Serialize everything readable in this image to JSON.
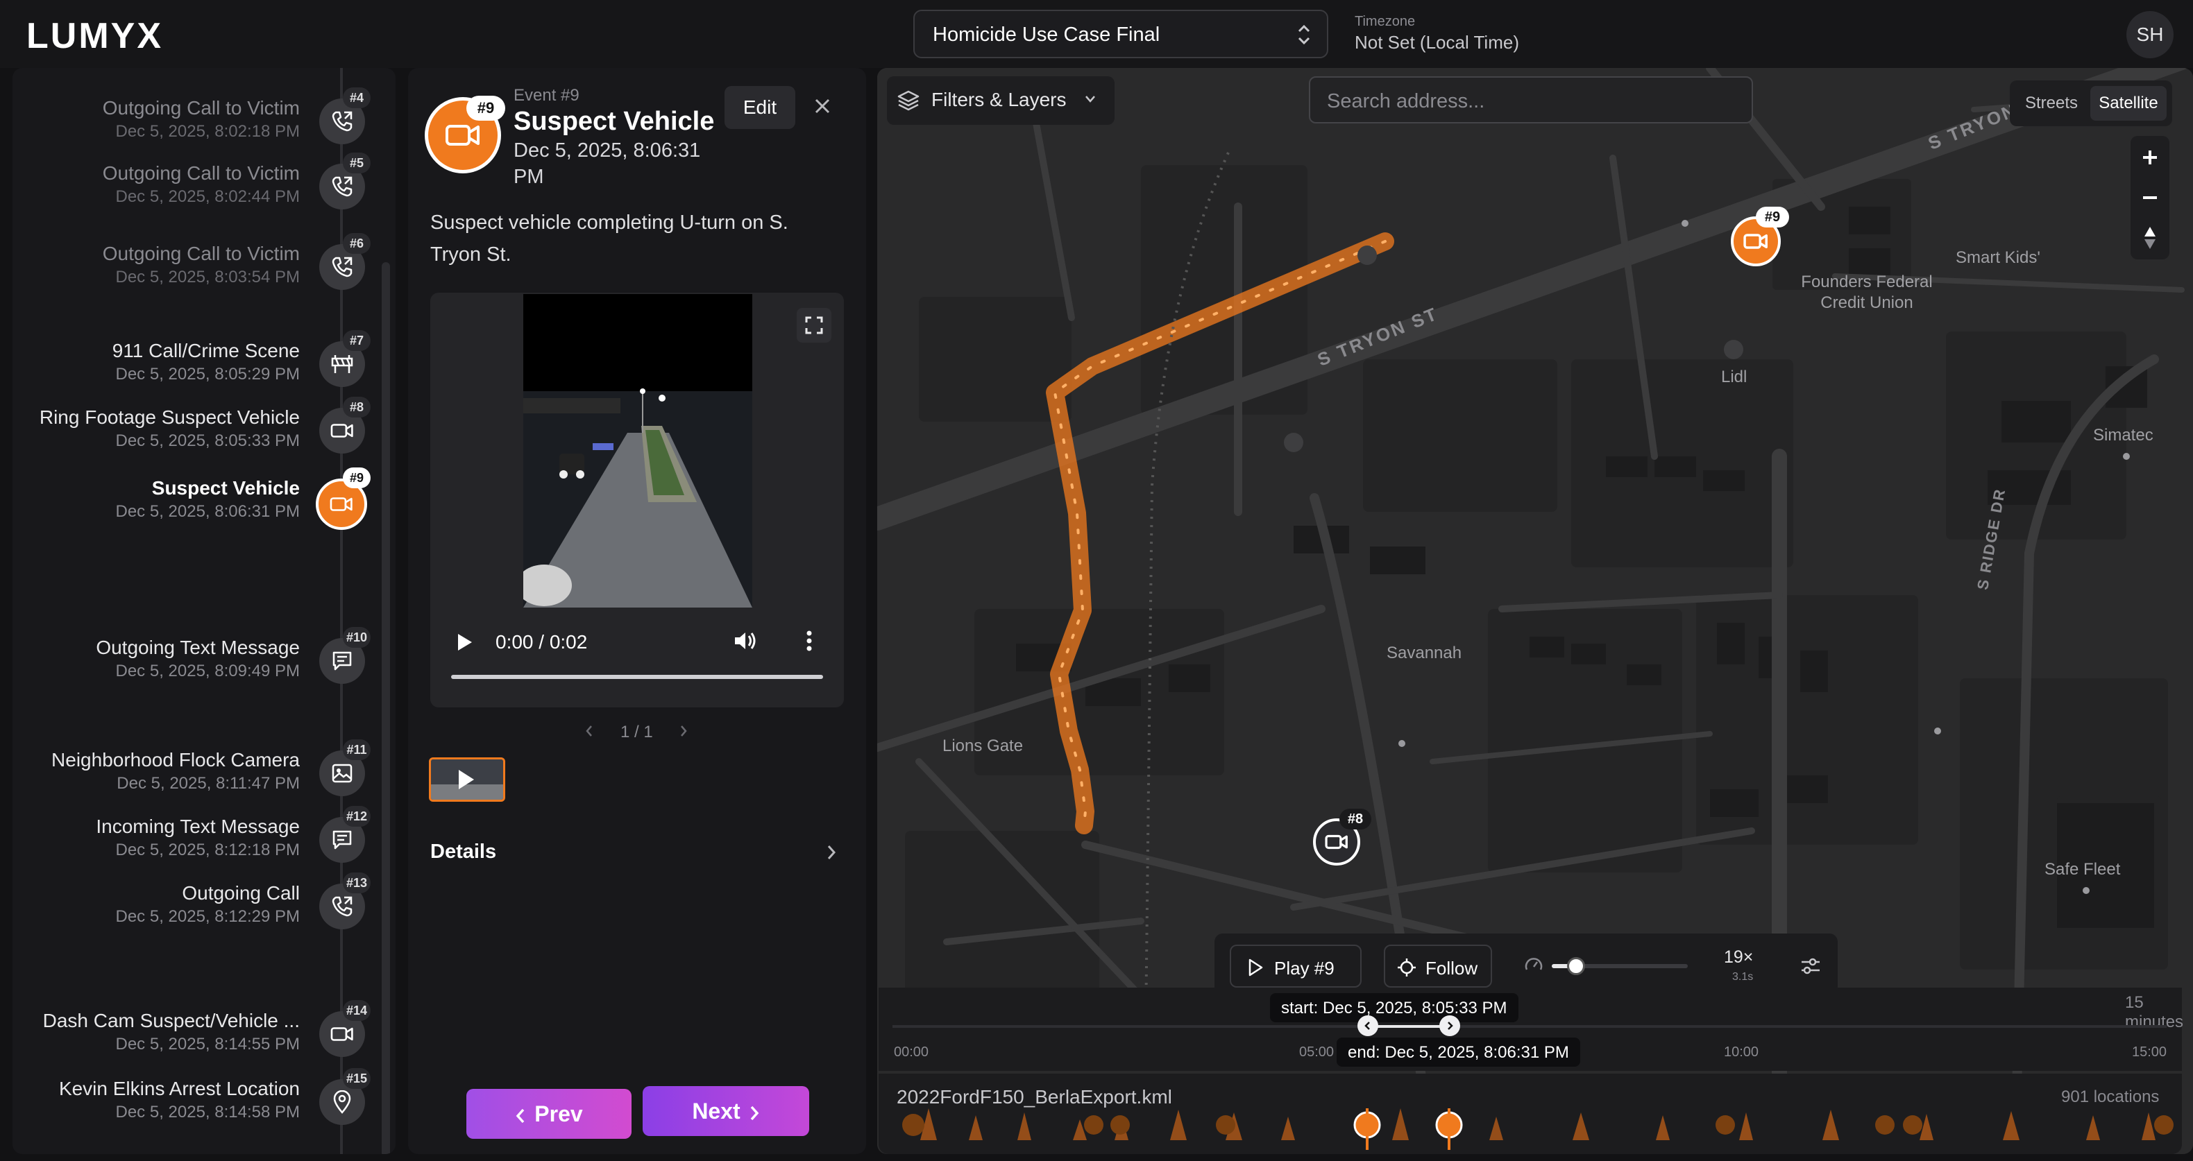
{
  "header": {
    "logo": "LUMYX",
    "case_name": "Homicide Use Case Final",
    "timezone_label": "Timezone",
    "timezone_value": "Not Set (Local Time)",
    "user_initials": "SH"
  },
  "events": [
    {
      "title": "Outgoing Call to Victim",
      "date": "Dec 5, 2025, 8:02:18 PM",
      "badge": "#4",
      "icon": "phone-outgoing-icon"
    },
    {
      "title": "Outgoing Call to Victim",
      "date": "Dec 5, 2025, 8:02:44 PM",
      "badge": "#5",
      "icon": "phone-outgoing-icon"
    },
    {
      "title": "Outgoing Call to Victim",
      "date": "Dec 5, 2025, 8:03:54 PM",
      "badge": "#6",
      "icon": "phone-outgoing-icon"
    },
    {
      "title": "911 Call/Crime Scene",
      "date": "Dec 5, 2025, 8:05:29 PM",
      "badge": "#7",
      "icon": "barrier-icon"
    },
    {
      "title": "Ring Footage Suspect Vehicle",
      "date": "Dec 5, 2025, 8:05:33 PM",
      "badge": "#8",
      "icon": "video-camera-icon"
    },
    {
      "title": "Suspect Vehicle",
      "date": "Dec 5, 2025, 8:06:31 PM",
      "badge": "#9",
      "icon": "video-camera-icon",
      "active": true
    },
    {
      "title": "Outgoing Text Message",
      "date": "Dec 5, 2025, 8:09:49 PM",
      "badge": "#10",
      "icon": "message-icon"
    },
    {
      "title": "Neighborhood Flock Camera",
      "date": "Dec 5, 2025, 8:11:47 PM",
      "badge": "#11",
      "icon": "image-icon"
    },
    {
      "title": "Incoming Text Message",
      "date": "Dec 5, 2025, 8:12:18 PM",
      "badge": "#12",
      "icon": "message-icon"
    },
    {
      "title": "Outgoing Call",
      "date": "Dec 5, 2025, 8:12:29 PM",
      "badge": "#13",
      "icon": "phone-outgoing-icon"
    },
    {
      "title": "Dash Cam Suspect/Vehicle ...",
      "date": "Dec 5, 2025, 8:14:55 PM",
      "badge": "#14",
      "icon": "video-camera-icon"
    },
    {
      "title": "Kevin Elkins Arrest Location",
      "date": "Dec 5, 2025, 8:14:58 PM",
      "badge": "#15",
      "icon": "location-pin-icon"
    }
  ],
  "detail": {
    "badge": "#9",
    "event_number": "Event #9",
    "title": "Suspect Vehicle",
    "date": "Dec 5, 2025, 8:06:31 PM",
    "edit_label": "Edit",
    "description": "Suspect vehicle completing U-turn on S. Tryon St.",
    "video_time": "0:00 / 0:02",
    "pager": "1 / 1",
    "details_label": "Details",
    "prev_label": "Prev",
    "next_label": "Next"
  },
  "map": {
    "filters_label": "Filters & Layers",
    "search_placeholder": "Search address...",
    "map_types": [
      "Streets",
      "Satellite"
    ],
    "selected_map_type": "Satellite",
    "street_labels": [
      "S TRYON ST",
      "S TRYON ST",
      "S RIDGE DR"
    ],
    "place_labels": [
      "Founders Federal Credit Union",
      "Smart Kids'",
      "Lidl",
      "Simatec",
      "Savannah",
      "Lions Gate",
      "Safe Fleet"
    ],
    "markers": [
      {
        "badge": "#9"
      },
      {
        "badge": "#8"
      }
    ]
  },
  "playback": {
    "play_label": "Play #9",
    "follow_label": "Follow",
    "speed": "19×",
    "speed_sub": "3.1s",
    "speed_fraction": 0.18
  },
  "timeline": {
    "range_label": "15 minutes",
    "ticks": [
      "00:00",
      "05:00",
      "10:00",
      "15:00"
    ],
    "start_label": "start: Dec 5, 2025, 8:05:33 PM",
    "end_label": "end: Dec 5, 2025, 8:06:31 PM",
    "track_name": "2022FordF150_BerlaExport.kml",
    "locations": "901 locations"
  },
  "colors": {
    "accent": "#f07a1e",
    "button_gradient_start": "#a04fe6",
    "button_gradient_end": "#d24bd0",
    "background": "#121214"
  }
}
